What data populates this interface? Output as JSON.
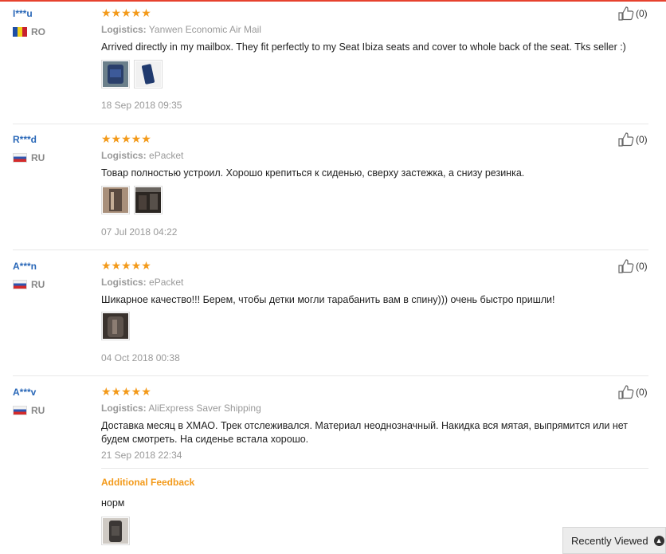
{
  "reviews": [
    {
      "user": "I***u",
      "country": "RO",
      "flag": "ro",
      "stars": "★★★★★",
      "logistics_label": "Logistics:",
      "logistics_value": "Yanwen Economic Air Mail",
      "text": "Arrived directly in my mailbox. They fit perfectly to my Seat Ibiza seats and cover to whole back of the seat. Tks seller :)",
      "date": "18 Sep 2018 09:35",
      "helpful": "(0)"
    },
    {
      "user": "R***d",
      "country": "RU",
      "flag": "ru",
      "stars": "★★★★★",
      "logistics_label": "Logistics:",
      "logistics_value": "ePacket",
      "text": "Товар полностью устроил. Хорошо крепиться к сиденью, сверху застежка, а снизу резинка.",
      "date": "07 Jul 2018 04:22",
      "helpful": "(0)"
    },
    {
      "user": "A***n",
      "country": "RU",
      "flag": "ru",
      "stars": "★★★★★",
      "logistics_label": "Logistics:",
      "logistics_value": "ePacket",
      "text": "Шикарное качество!!! Берем, чтобы детки могли тарабанить вам в спину))) очень быстро пришли!",
      "date": "04 Oct 2018 00:38",
      "helpful": "(0)"
    },
    {
      "user": "A***v",
      "country": "RU",
      "flag": "ru",
      "stars": "★★★★★",
      "logistics_label": "Logistics:",
      "logistics_value": "AliExpress Saver Shipping",
      "text": "Доставка месяц в ХМАО. Трек отслеживался. Материал неоднозначный. Накидка вся мятая, выпрямится или нет будем смотреть. На сиденье встала хорошо.",
      "date": "21 Sep 2018 22:34",
      "helpful": "(0)",
      "additional_label": "Additional Feedback",
      "additional_text": "норм"
    }
  ],
  "recently_viewed": "Recently Viewed",
  "colors": {
    "accent": "#f39a1a",
    "user": "#2a68b8",
    "topline": "#e6422e"
  }
}
